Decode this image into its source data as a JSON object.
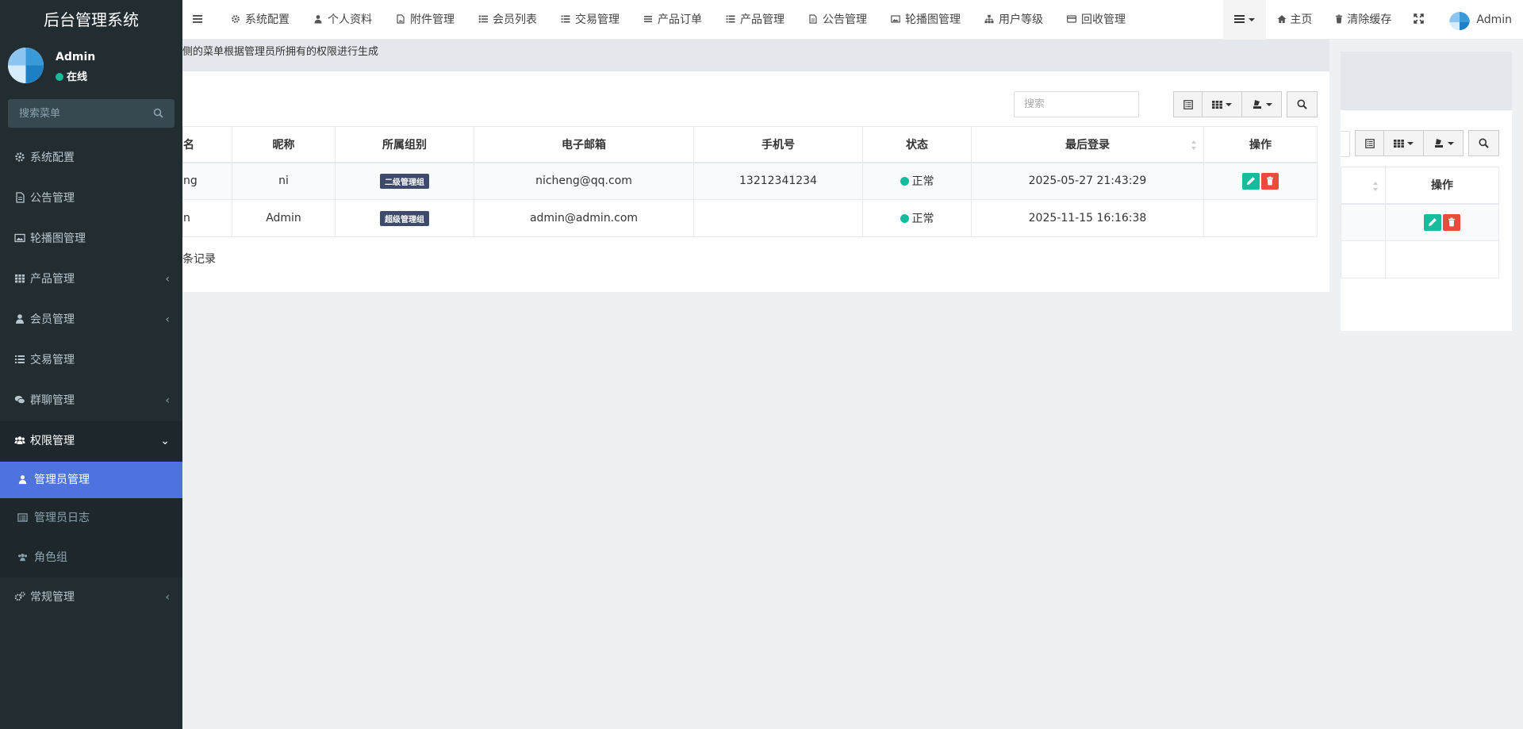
{
  "sidebar": {
    "brand": "后台管理系统",
    "user_name": "Admin",
    "user_status": "在线",
    "search_placeholder": "搜索菜单",
    "menu": [
      {
        "label": "系统配置",
        "icon": "gear-icon",
        "has_arrow": false
      },
      {
        "label": "公告管理",
        "icon": "file-icon",
        "has_arrow": false
      },
      {
        "label": "轮播图管理",
        "icon": "image-icon",
        "has_arrow": false
      },
      {
        "label": "产品管理",
        "icon": "grid-icon",
        "has_arrow": true
      },
      {
        "label": "会员管理",
        "icon": "user-icon",
        "has_arrow": true
      },
      {
        "label": "交易管理",
        "icon": "list-icon",
        "has_arrow": false
      },
      {
        "label": "群聊管理",
        "icon": "comments-icon",
        "has_arrow": true
      },
      {
        "label": "权限管理",
        "icon": "group-icon",
        "has_arrow": true,
        "open": true
      },
      {
        "label": "常规管理",
        "icon": "cogs-icon",
        "has_arrow": true
      }
    ],
    "submenu": [
      {
        "label": "管理员管理",
        "icon": "user-icon",
        "active": true
      },
      {
        "label": "管理员日志",
        "icon": "list-alt-icon",
        "active": false
      },
      {
        "label": "角色组",
        "icon": "group-icon",
        "active": false
      }
    ]
  },
  "navbar": {
    "tabs": [
      {
        "label": "系统配置",
        "icon": "gear-icon"
      },
      {
        "label": "个人资料",
        "icon": "user-icon"
      },
      {
        "label": "附件管理",
        "icon": "file-image-icon"
      },
      {
        "label": "会员列表",
        "icon": "list-ul-icon"
      },
      {
        "label": "交易管理",
        "icon": "list-icon"
      },
      {
        "label": "产品订单",
        "icon": "bars-icon"
      },
      {
        "label": "产品管理",
        "icon": "list-icon"
      },
      {
        "label": "公告管理",
        "icon": "file-icon"
      },
      {
        "label": "轮播图管理",
        "icon": "image-icon"
      },
      {
        "label": "用户等级",
        "icon": "sitemap-icon"
      },
      {
        "label": "回收管理",
        "icon": "credit-card-icon"
      }
    ],
    "home": "主页",
    "clear_cache": "清除缓存",
    "user": "Admin"
  },
  "content": {
    "hint": "侧的菜单根据管理员所拥有的权限进行生成",
    "search_placeholder": "搜索",
    "columns": [
      "名",
      "昵称",
      "所属组别",
      "电子邮箱",
      "手机号",
      "状态",
      "最后登录",
      "操作"
    ],
    "rows": [
      {
        "username": "ng",
        "nickname": "ni",
        "group": "二级管理组",
        "email": "nicheng@qq.com",
        "mobile": "13212341234",
        "status": "正常",
        "last_login": "2025-05-27 21:43:29",
        "actions": true
      },
      {
        "username": "n",
        "nickname": "Admin",
        "group": "超级管理组",
        "email": "admin@admin.com",
        "mobile": "",
        "status": "正常",
        "last_login": "2025-11-15 16:16:38",
        "actions": false
      }
    ],
    "records": "条记录"
  },
  "right_panel": {
    "action_header": "操作"
  },
  "colors": {
    "sidebar_bg": "#222d32",
    "active_blue": "#4e73df",
    "success": "#18bc9c",
    "danger": "#e74c3c",
    "badge": "#3d4a6b"
  }
}
